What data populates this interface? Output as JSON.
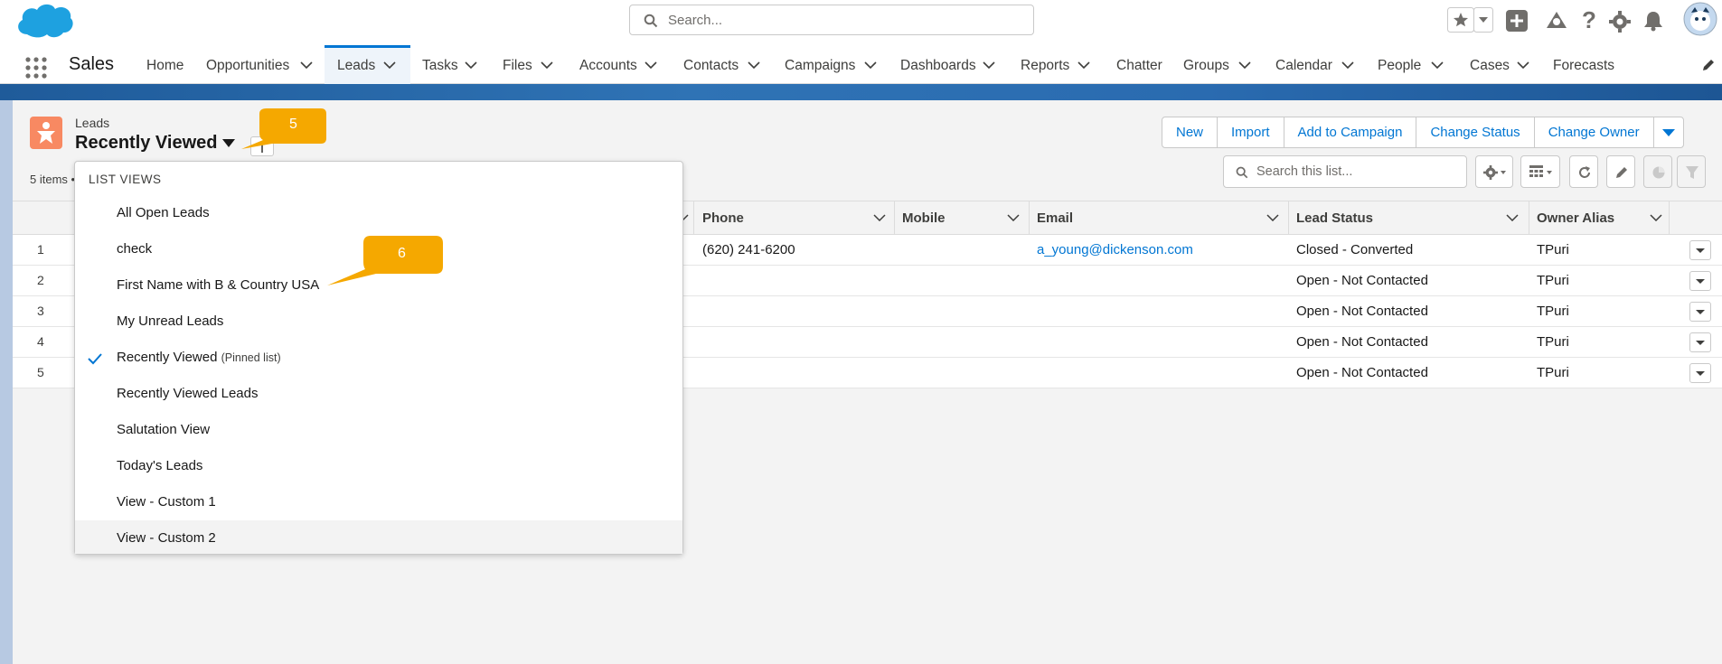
{
  "header": {
    "search_placeholder": "Search...",
    "icons": [
      "salesforce-cloud-icon",
      "search-icon",
      "favorites-star-icon",
      "chevron-down-icon",
      "add-icon",
      "trailhead-icon",
      "help-icon",
      "setup-gear-icon",
      "notifications-bell-icon",
      "user-avatar"
    ]
  },
  "nav": {
    "app_name": "Sales",
    "items": [
      {
        "label": "Home"
      },
      {
        "label": "Opportunities"
      },
      {
        "label": "Leads"
      },
      {
        "label": "Tasks"
      },
      {
        "label": "Files"
      },
      {
        "label": "Accounts"
      },
      {
        "label": "Contacts"
      },
      {
        "label": "Campaigns"
      },
      {
        "label": "Dashboards"
      },
      {
        "label": "Reports"
      },
      {
        "label": "Chatter"
      },
      {
        "label": "Groups"
      },
      {
        "label": "Calendar"
      },
      {
        "label": "People"
      },
      {
        "label": "Cases"
      },
      {
        "label": "Forecasts"
      }
    ],
    "active": "Leads"
  },
  "list_header": {
    "object_label": "Leads",
    "list_name": "Recently Viewed",
    "items_count": "5 items •",
    "search_placeholder": "Search this list..."
  },
  "actions": {
    "new": "New",
    "import": "Import",
    "add_to_campaign": "Add to Campaign",
    "change_status": "Change Status",
    "change_owner": "Change Owner"
  },
  "table": {
    "columns": {
      "phone": "Phone",
      "mobile": "Mobile",
      "email": "Email",
      "lead_status": "Lead Status",
      "owner_alias": "Owner Alias"
    },
    "rows": [
      {
        "num": "1",
        "phone": "(620) 241-6200",
        "mobile": "",
        "email": "a_young@dickenson.com",
        "status": "Closed - Converted",
        "owner": "TPuri"
      },
      {
        "num": "2",
        "phone": "",
        "mobile": "",
        "email": "",
        "status": "Open - Not Contacted",
        "owner": "TPuri"
      },
      {
        "num": "3",
        "phone": "",
        "mobile": "",
        "email": "",
        "status": "Open - Not Contacted",
        "owner": "TPuri"
      },
      {
        "num": "4",
        "phone": "",
        "mobile": "",
        "email": "",
        "status": "Open - Not Contacted",
        "owner": "TPuri"
      },
      {
        "num": "5",
        "phone": "",
        "mobile": "",
        "email": "",
        "status": "Open - Not Contacted",
        "owner": "TPuri"
      }
    ]
  },
  "list_views": {
    "header": "LIST VIEWS",
    "items": [
      {
        "label": "All Open Leads",
        "sub": ""
      },
      {
        "label": "check",
        "sub": ""
      },
      {
        "label": "First Name with B & Country USA",
        "sub": ""
      },
      {
        "label": "My Unread Leads",
        "sub": ""
      },
      {
        "label": "Recently Viewed",
        "sub": "(Pinned list)"
      },
      {
        "label": "Recently Viewed Leads",
        "sub": ""
      },
      {
        "label": "Salutation View",
        "sub": ""
      },
      {
        "label": "Today's Leads",
        "sub": ""
      },
      {
        "label": "View - Custom 1",
        "sub": ""
      },
      {
        "label": "View - Custom 2",
        "sub": ""
      }
    ],
    "selected": "Recently Viewed"
  },
  "callouts": [
    {
      "number": "5"
    },
    {
      "number": "6"
    }
  ],
  "colors": {
    "brand_blue": "#0176d3",
    "lead_icon": "#f88962",
    "callout": "#f5a800",
    "band": "#2f73b5"
  }
}
